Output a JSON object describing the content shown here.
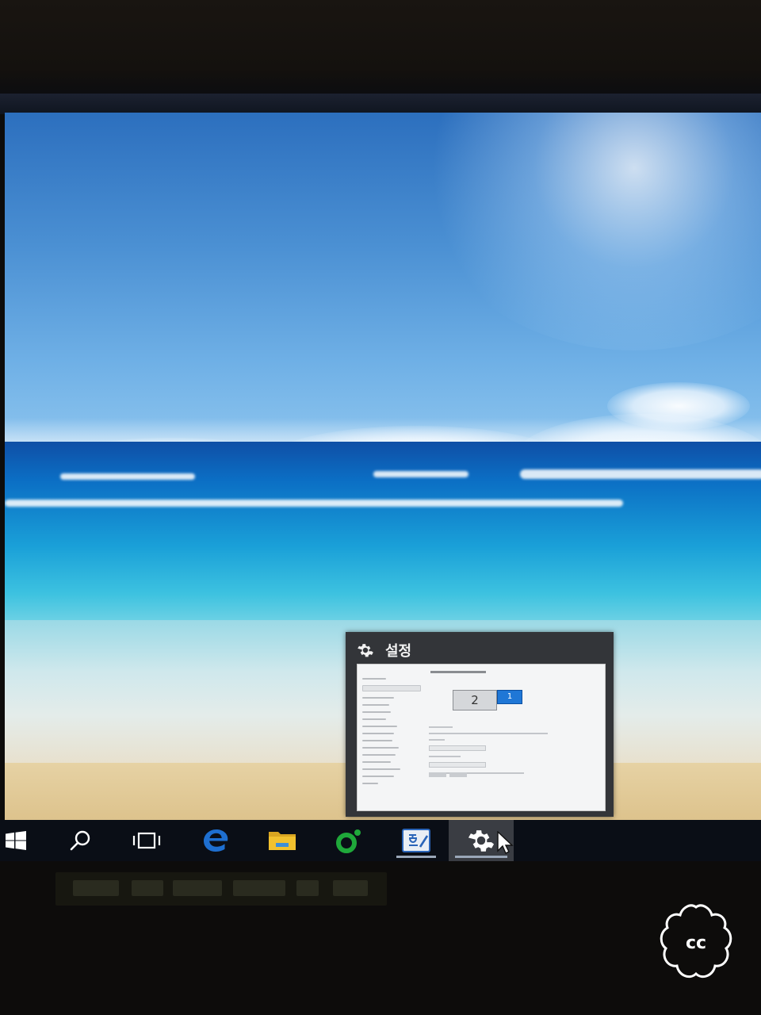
{
  "preview": {
    "title": "설정",
    "icon": "gear-icon",
    "monitor_primary_label": "1",
    "monitor_secondary_label": "2"
  },
  "taskbar": {
    "items": [
      {
        "name": "start-button",
        "icon": "windows-logo-icon"
      },
      {
        "name": "search-button",
        "icon": "search-icon"
      },
      {
        "name": "task-view-button",
        "icon": "task-view-icon"
      },
      {
        "name": "edge-button",
        "icon": "edge-icon"
      },
      {
        "name": "file-explorer-button",
        "icon": "folder-icon"
      },
      {
        "name": "app-green-button",
        "icon": "green-app-icon"
      },
      {
        "name": "hangul-button",
        "icon": "hangul-icon",
        "active": true
      },
      {
        "name": "settings-button",
        "icon": "gear-icon",
        "active": true,
        "focused": true
      }
    ]
  },
  "colors": {
    "taskbar_bg": "#0a0e16",
    "preview_bg": "#333539",
    "accent_blue": "#1f77d6",
    "edge_blue": "#1e6fd0",
    "folder_yellow": "#f2c12e",
    "app_green": "#1fa83a"
  },
  "watermark": {
    "text": "cc"
  }
}
